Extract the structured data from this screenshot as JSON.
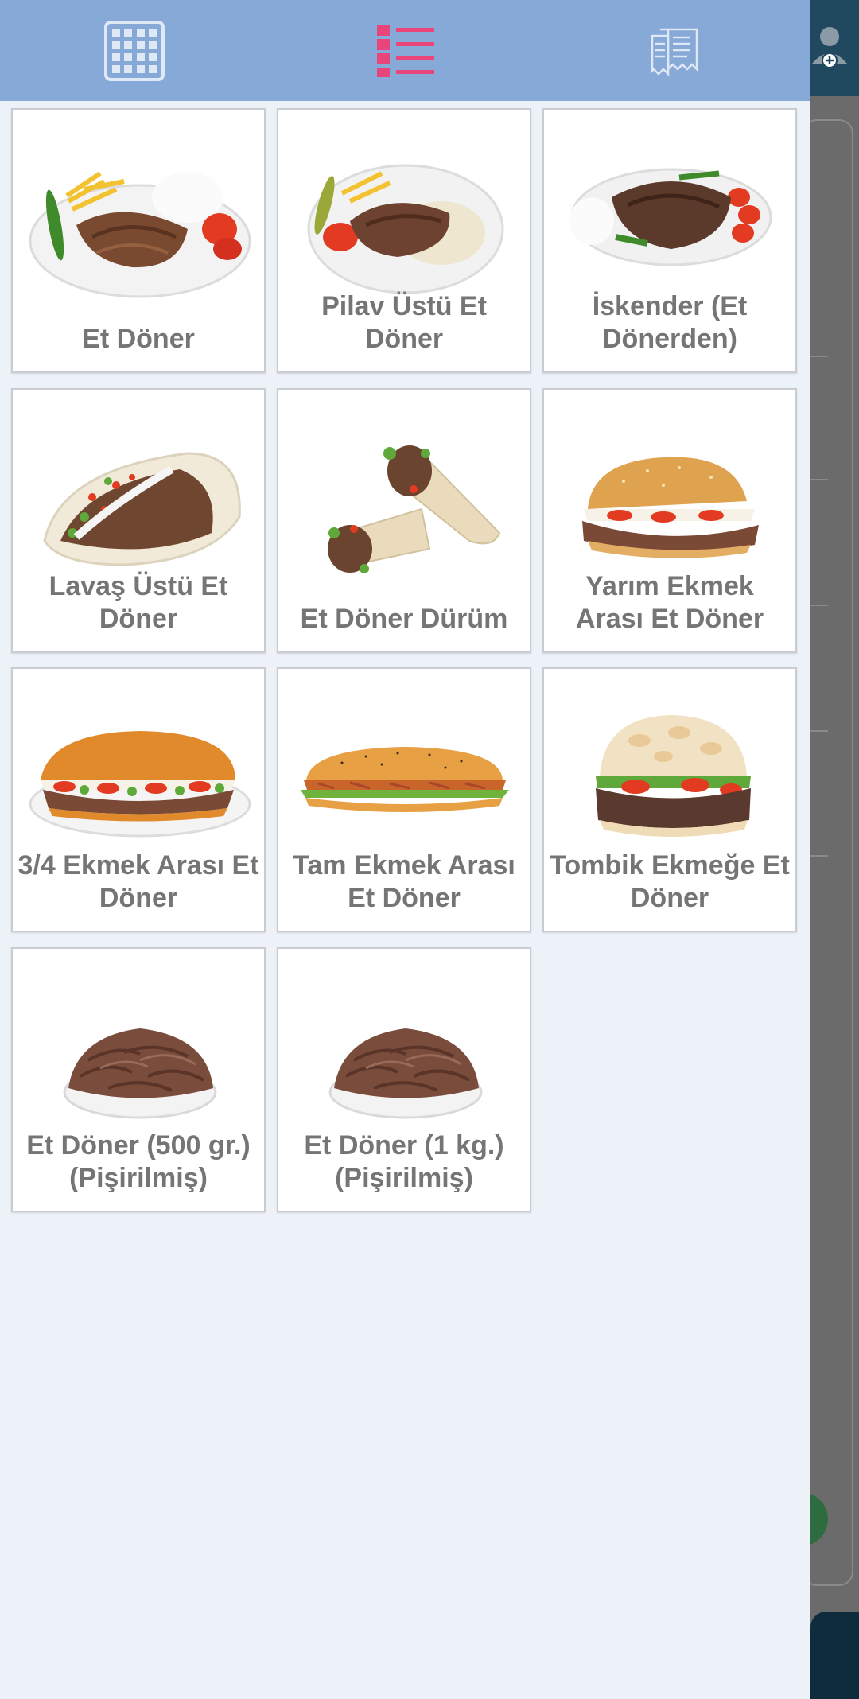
{
  "colors": {
    "header_bg": "#87a9d7",
    "drawer_bg": "#edf1f8",
    "active_icon": "#e8457a",
    "inactive_icon": "#dfe8f5",
    "product_text": "#757575"
  },
  "header": {
    "icons": [
      "grid-icon",
      "list-icon",
      "receipt-icon"
    ],
    "active_view": "list"
  },
  "products": [
    {
      "name": "Et Döner",
      "image": "doner-plate-rice-fries"
    },
    {
      "name": "Pilav Üstü Et Döner",
      "image": "doner-on-rice"
    },
    {
      "name": "İskender (Et Dönerden)",
      "image": "iskender-plate"
    },
    {
      "name": "Lavaş Üstü Et Döner",
      "image": "doner-on-lavash"
    },
    {
      "name": "Et Döner Dürüm",
      "image": "durum-wrap"
    },
    {
      "name": "Yarım Ekmek Arası Et Döner",
      "image": "half-bread-sandwich"
    },
    {
      "name": "3/4 Ekmek Arası Et Döner",
      "image": "three-quarter-bread-sandwich"
    },
    {
      "name": "Tam Ekmek Arası Et Döner",
      "image": "full-bread-sandwich"
    },
    {
      "name": "Tombik Ekmeğe Et Döner",
      "image": "tombik-bread"
    },
    {
      "name": "Et Döner (500 gr.) (Pişirilmiş)",
      "image": "cooked-doner-plate"
    },
    {
      "name": "Et Döner (1 kg.) (Pişirilmiş)",
      "image": "cooked-doner-plate"
    }
  ]
}
